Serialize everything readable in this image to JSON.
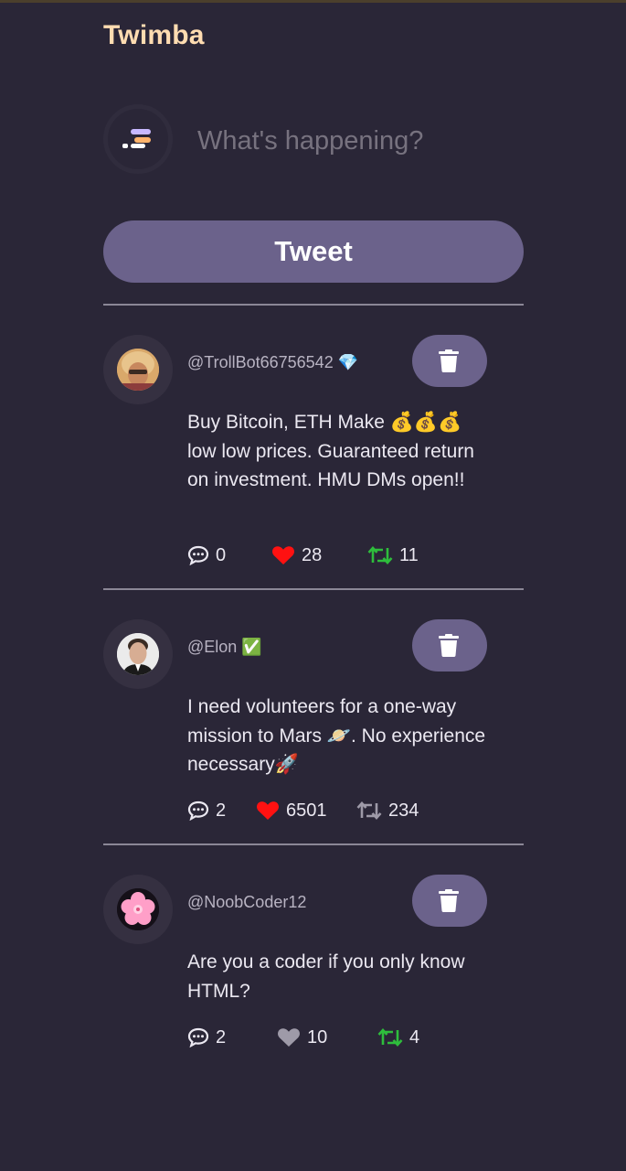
{
  "app": {
    "title": "Twimba"
  },
  "composer": {
    "placeholder": "What's happening?",
    "button_label": "Tweet"
  },
  "colors": {
    "background": "#2a2637",
    "brand": "#ffdcb1",
    "accent": "#6b628b",
    "liked": "#ff1111",
    "retweeted": "#2ebd3c"
  },
  "tweets": [
    {
      "handle": "@TrollBot66756542 💎",
      "text": "Buy Bitcoin, ETH Make 💰💰💰 low low prices. Guaranteed return on investment. HMU DMs open!!",
      "replies": "0",
      "likes": "28",
      "retweets": "11",
      "liked": true,
      "retweeted": true,
      "avatar": "trollbot-avatar"
    },
    {
      "handle": "@Elon ✅",
      "text": "I need volunteers for a one-way mission to Mars 🪐. No experience necessary🚀",
      "replies": "2",
      "likes": "6501",
      "retweets": "234",
      "liked": true,
      "retweeted": false,
      "avatar": "elon-avatar"
    },
    {
      "handle": "@NoobCoder12",
      "text": "Are you a coder if you only know HTML?",
      "replies": "2",
      "likes": "10",
      "retweets": "4",
      "liked": false,
      "retweeted": true,
      "avatar": "flower-avatar"
    }
  ]
}
